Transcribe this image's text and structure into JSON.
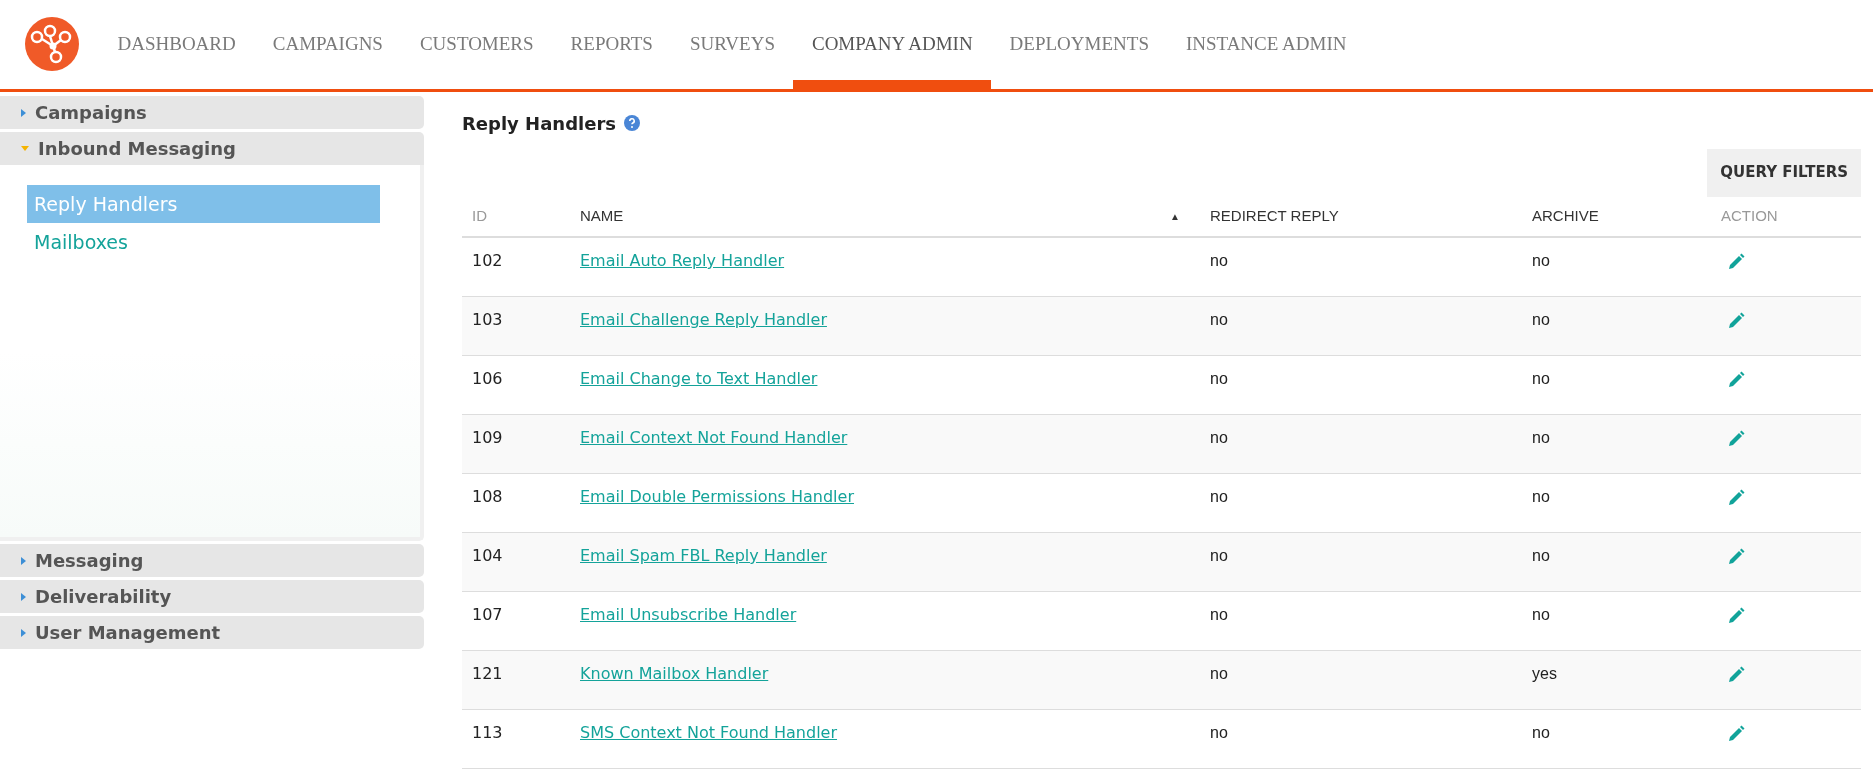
{
  "nav": {
    "items": [
      {
        "label": "DASHBOARD",
        "selected": false
      },
      {
        "label": "CAMPAIGNS",
        "selected": false
      },
      {
        "label": "CUSTOMERS",
        "selected": false
      },
      {
        "label": "REPORTS",
        "selected": false
      },
      {
        "label": "SURVEYS",
        "selected": false
      },
      {
        "label": "COMPANY ADMIN",
        "selected": true
      },
      {
        "label": "DEPLOYMENTS",
        "selected": false
      },
      {
        "label": "INSTANCE ADMIN",
        "selected": false
      }
    ]
  },
  "sidebar": {
    "sections": [
      {
        "label": "Campaigns",
        "expanded": false
      },
      {
        "label": "Inbound Messaging",
        "expanded": true,
        "children": [
          {
            "label": "Reply Handlers",
            "selected": true
          },
          {
            "label": "Mailboxes",
            "selected": false
          }
        ]
      },
      {
        "label": "Messaging",
        "expanded": false
      },
      {
        "label": "Deliverability",
        "expanded": false
      },
      {
        "label": "User Management",
        "expanded": false
      }
    ]
  },
  "page_title": "Reply Handlers",
  "query_filters_button": "QUERY FILTERS",
  "table": {
    "columns": [
      "ID",
      "NAME",
      "REDIRECT REPLY",
      "ARCHIVE",
      "ACTION"
    ],
    "sort_indicator": "▲",
    "rows": [
      {
        "id": "102",
        "name": "Email Auto Reply Handler",
        "redirect_reply": "no",
        "archive": "no"
      },
      {
        "id": "103",
        "name": "Email Challenge Reply Handler",
        "redirect_reply": "no",
        "archive": "no"
      },
      {
        "id": "106",
        "name": "Email Change to Text Handler",
        "redirect_reply": "no",
        "archive": "no"
      },
      {
        "id": "109",
        "name": "Email Context Not Found Handler",
        "redirect_reply": "no",
        "archive": "no"
      },
      {
        "id": "108",
        "name": "Email Double Permissions Handler",
        "redirect_reply": "no",
        "archive": "no"
      },
      {
        "id": "104",
        "name": "Email Spam FBL Reply Handler",
        "redirect_reply": "no",
        "archive": "no"
      },
      {
        "id": "107",
        "name": "Email Unsubscribe Handler",
        "redirect_reply": "no",
        "archive": "no"
      },
      {
        "id": "121",
        "name": "Known Mailbox Handler",
        "redirect_reply": "no",
        "archive": "yes"
      },
      {
        "id": "113",
        "name": "SMS Context Not Found Handler",
        "redirect_reply": "no",
        "archive": "no"
      }
    ]
  }
}
